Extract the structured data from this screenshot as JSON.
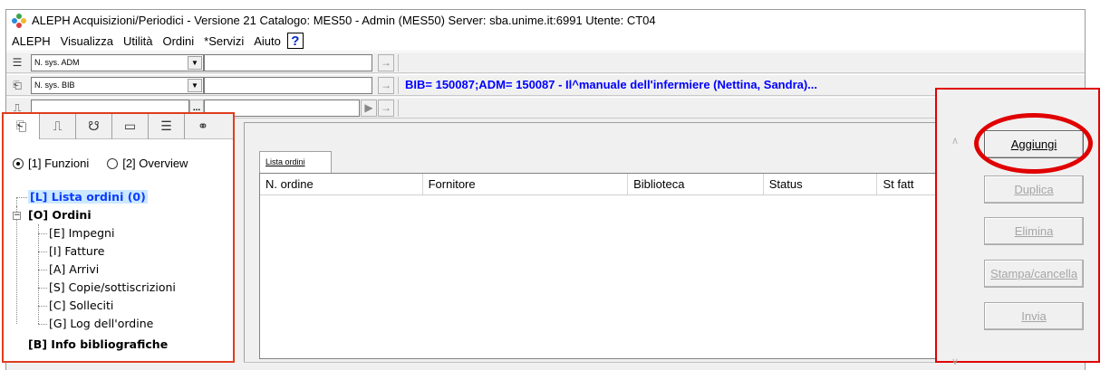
{
  "window": {
    "title": "ALEPH Acquisizioni/Periodici  - Versione 21  Catalogo:  MES50 - Admin (MES50)  Server:  sba.unime.it:6991  Utente:  CT04"
  },
  "menu": [
    "ALEPH",
    "Visualizza",
    "Utilità",
    "Ordini",
    "*Servizi",
    "Aiuto"
  ],
  "help_label": "?",
  "toolbar": {
    "row1": {
      "combo_value": "N. sys. ADM",
      "input_value": "",
      "icon": "list-icon"
    },
    "row2": {
      "combo_value": "N. sys. BIB",
      "input_value": "",
      "icon": "book-icon",
      "info": "BIB= 150087;ADM= 150087 - Il^manuale dell'infermiere (Nettina, Sandra)..."
    },
    "row3": {
      "input_value": "",
      "icon": "stamp-icon",
      "browse_label": "..."
    }
  },
  "left_panel": {
    "tabs": [
      "book-icon",
      "stamp-icon",
      "cup-icon",
      "folder-icon",
      "list-icon",
      "binoculars-icon"
    ],
    "radio_options": [
      {
        "label": "[1] Funzioni",
        "selected": true
      },
      {
        "label": "[2] Overview",
        "selected": false
      }
    ],
    "tree": {
      "selected": "[L] Lista ordini (0)",
      "group": "[O] Ordini",
      "children": [
        "[E] Impegni",
        "[I] Fatture",
        "[A] Arrivi",
        "[S] Copie/sottiscrizioni",
        "[C] Solleciti",
        "[G] Log dell'ordine"
      ],
      "next_group": "[B] Info bibliografiche"
    }
  },
  "main": {
    "tab_label": "Lista ordini",
    "columns": [
      "N. ordine",
      "Fornitore",
      "Biblioteca",
      "Status",
      "St fatt"
    ]
  },
  "actions": {
    "buttons": [
      {
        "label": "Aggiungi",
        "enabled": true
      },
      {
        "label": "Duplica",
        "enabled": false
      },
      {
        "label": "Elimina",
        "enabled": false
      },
      {
        "label": "Stampa/cancella",
        "enabled": false
      },
      {
        "label": "Invia",
        "enabled": false
      }
    ],
    "highlight_color": "#e00000"
  },
  "colors": {
    "link_blue": "#0000ff",
    "selection": "#cce8ff",
    "left_border": "#e03c1e",
    "callout_red": "#e00000"
  }
}
